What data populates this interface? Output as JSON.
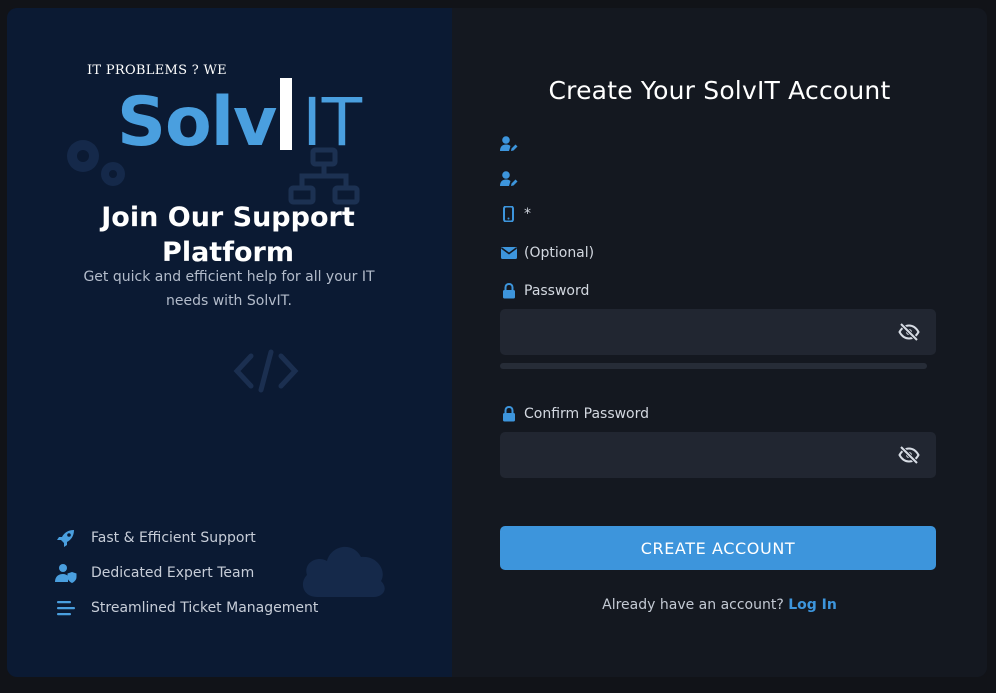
{
  "brand": {
    "tagline": "IT PROBLEMS ? WE",
    "logo_part1": "Solv",
    "logo_part2": "IT"
  },
  "left": {
    "title": "Join Our Support Platform",
    "subtitle": "Get quick and efficient help for all your IT needs with SolvIT.",
    "features": [
      {
        "icon": "rocket-icon",
        "label": "Fast & Efficient Support"
      },
      {
        "icon": "user-shield-icon",
        "label": "Dedicated Expert Team"
      },
      {
        "icon": "list-lines-icon",
        "label": "Streamlined Ticket Management"
      }
    ]
  },
  "form": {
    "title": "Create Your SolvIT Account",
    "fields": [
      {
        "icon": "user-edit-icon",
        "label": ""
      },
      {
        "icon": "user-edit-icon",
        "label": ""
      },
      {
        "icon": "mobile-phone-icon",
        "label": "*"
      },
      {
        "icon": "envelope-icon",
        "label": "(Optional)"
      },
      {
        "icon": "lock-icon",
        "label": "Password"
      },
      {
        "icon": "lock-icon",
        "label": "Confirm Password"
      }
    ],
    "password_value": "",
    "confirm_password_value": "",
    "password_strength": 0,
    "submit_label": "CREATE ACCOUNT",
    "login_prompt": "Already have an account?",
    "login_link": "Log In"
  },
  "colors": {
    "accent": "#3d95dc",
    "logo_blue": "#4a9fdf",
    "left_panel_bg": "#0b1a33",
    "right_panel_bg": "#141820",
    "input_bg": "#212631"
  }
}
